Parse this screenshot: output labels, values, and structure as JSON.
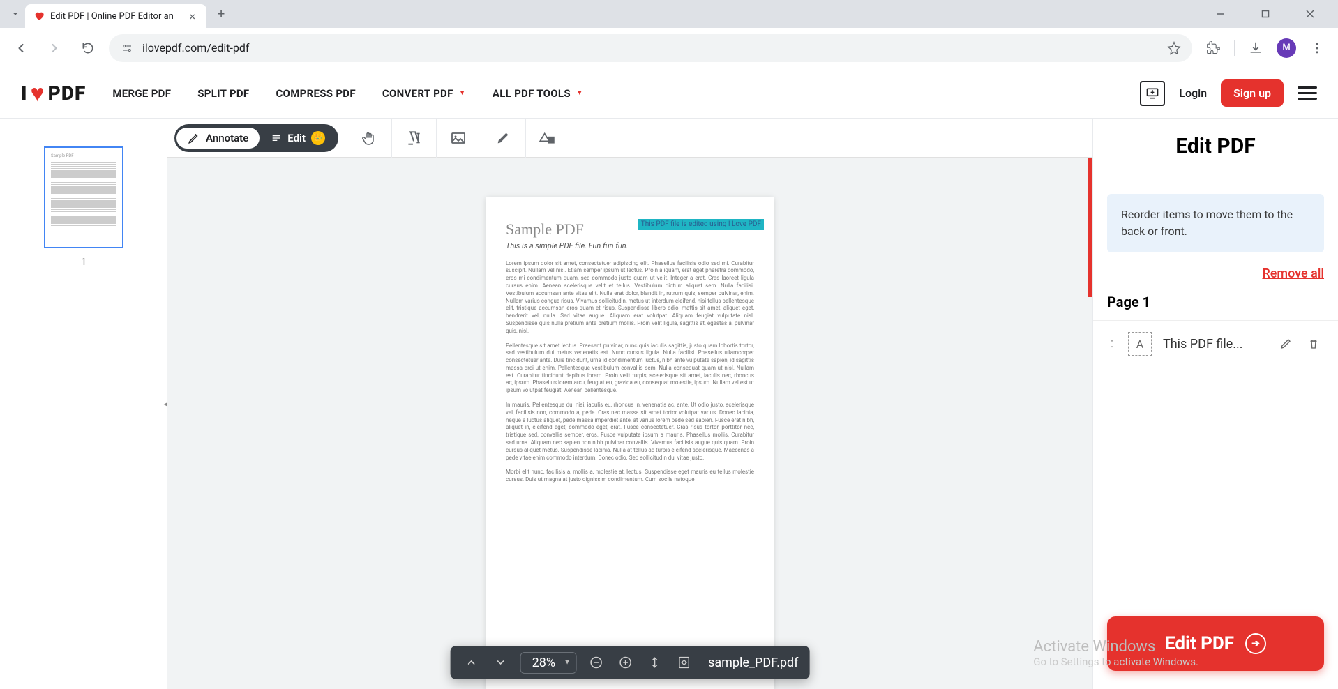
{
  "browser": {
    "tab_title": "Edit PDF | Online PDF Editor an",
    "url": "ilovepdf.com/edit-pdf",
    "avatar_initial": "M"
  },
  "header": {
    "logo_prefix": "I",
    "logo_suffix": "PDF",
    "nav": {
      "merge": "MERGE PDF",
      "split": "SPLIT PDF",
      "compress": "COMPRESS PDF",
      "convert": "CONVERT PDF",
      "all_tools": "ALL PDF TOOLS"
    },
    "login": "Login",
    "signup": "Sign up"
  },
  "toolbar": {
    "annotate": "Annotate",
    "edit": "Edit"
  },
  "thumbnail": {
    "page_number": "1"
  },
  "document": {
    "title": "Sample PDF",
    "highlight": "This PDF file is edited using I Love PDF",
    "subtitle": "This is a simple PDF file. Fun fun fun.",
    "para1": "Lorem ipsum dolor sit amet, consectetuer adipiscing elit. Phasellus facilisis odio sed mi. Curabitur suscipit. Nullam vel nisi. Etiam semper ipsum ut lectus. Proin aliquam, erat eget pharetra commodo, eros mi condimentum quam, sed commodo justo quam ut velit. Integer a erat. Cras laoreet ligula cursus enim. Aenean scelerisque velit et tellus. Vestibulum dictum aliquet sem. Nulla facilisi. Vestibulum accumsan ante vitae elit. Nulla erat dolor, blandit in, rutrum quis, semper pulvinar, enim. Nullam varius congue risus. Vivamus sollicitudin, metus ut interdum eleifend, nisi tellus pellentesque elit, tristique accumsan eros quam et risus. Suspendisse libero odio, mattis sit amet, aliquet eget, hendrerit vel, nulla. Sed vitae augue. Aliquam erat volutpat. Aliquam feugiat vulputate nisl. Suspendisse quis nulla pretium ante pretium mollis. Proin velit ligula, sagittis at, egestas a, pulvinar quis, nisl.",
    "para2": "Pellentesque sit amet lectus. Praesent pulvinar, nunc quis iaculis sagittis, justo quam lobortis tortor, sed vestibulum dui metus venenatis est. Nunc cursus ligula. Nulla facilisi. Phasellus ullamcorper consectetuer ante. Duis tincidunt, urna id condimentum luctus, nibh ante vulputate sapien, id sagittis massa orci ut enim. Pellentesque vestibulum convallis sem. Nulla consequat quam ut nisl. Nullam est. Curabitur tincidunt dapibus lorem. Proin velit turpis, scelerisque sit amet, iaculis nec, rhoncus ac, ipsum. Phasellus lorem arcu, feugiat eu, gravida eu, consequat molestie, ipsum. Nullam vel est ut ipsum volutpat feugiat. Aenean pellentesque.",
    "para3": "In mauris. Pellentesque dui nisi, iaculis eu, rhoncus in, venenatis ac, ante. Ut odio justo, scelerisque vel, facilisis non, commodo a, pede. Cras nec massa sit amet tortor volutpat varius. Donec lacinia, neque a luctus aliquet, pede massa imperdiet ante, at varius lorem pede sed sapien. Fusce erat nibh, aliquet in, eleifend eget, commodo eget, erat. Fusce consectetuer. Cras risus tortor, porttitor nec, tristique sed, convallis semper, eros. Fusce vulputate ipsum a mauris. Phasellus mollis. Curabitur sed urna. Aliquam nec sapien non nibh pulvinar convallis. Vivamus facilisis augue quis quam. Proin cursus aliquet metus. Suspendisse lacinia. Nulla at tellus ac turpis eleifend scelerisque. Maecenas a pede vitae enim commodo interdum. Donec odio. Sed sollicitudin dui vitae justo.",
    "para4": "Morbi elit nunc, facilisis a, mollis a, molestie at, lectus. Suspendisse eget mauris eu tellus molestie cursus. Duis ut magna at justo dignissim condimentum. Cum sociis natoque"
  },
  "bottom_bar": {
    "zoom": "28%",
    "filename": "sample_PDF.pdf"
  },
  "right_panel": {
    "title": "Edit PDF",
    "info": "Reorder items to move them to the back or front.",
    "remove_all": "Remove all",
    "page_label": "Page 1",
    "item_text": "This PDF file...",
    "item_type_glyph": "A",
    "cta": "Edit PDF"
  },
  "watermark": {
    "title": "Activate Windows",
    "sub": "Go to Settings to activate Windows."
  }
}
